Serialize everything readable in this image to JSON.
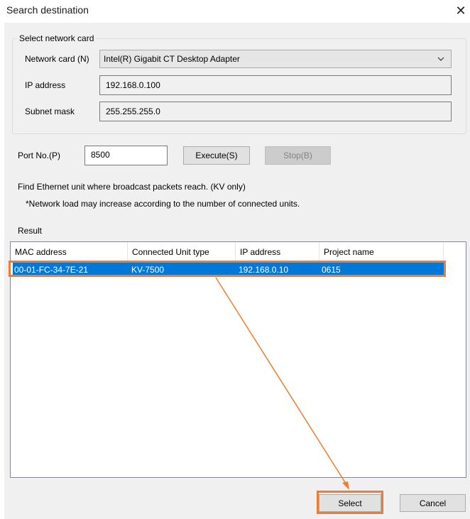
{
  "window": {
    "title": "Search destination",
    "close_glyph": "✕"
  },
  "network_group": {
    "label": "Select network card",
    "network_card_label": "Network card (N)",
    "network_card_value": "Intel(R) Gigabit CT Desktop Adapter",
    "ip_label": "IP address",
    "ip_value": "192.168.0.100",
    "subnet_label": "Subnet mask",
    "subnet_value": "255.255.255.0"
  },
  "search": {
    "port_label": "Port No.(P)",
    "port_value": "8500",
    "execute_label": "Execute(S)",
    "stop_label": "Stop(B)"
  },
  "info": {
    "line1": "Find Ethernet unit where broadcast packets reach. (KV only)",
    "line2": "*Network load may increase according to the number of connected units."
  },
  "result": {
    "label": "Result",
    "columns": [
      "MAC address",
      "Connected Unit type",
      "IP address",
      "Project name"
    ],
    "rows": [
      [
        "00-01-FC-34-7E-21",
        "KV-7500",
        "192.168.0.10",
        "0615"
      ]
    ]
  },
  "footer": {
    "select_label": "Select",
    "cancel_label": "Cancel"
  },
  "colors": {
    "annotation": "#ed7d31",
    "selection": "#0078d7"
  },
  "icons": {
    "combo_arrow": "chevron-down-icon",
    "close": "close-icon"
  }
}
